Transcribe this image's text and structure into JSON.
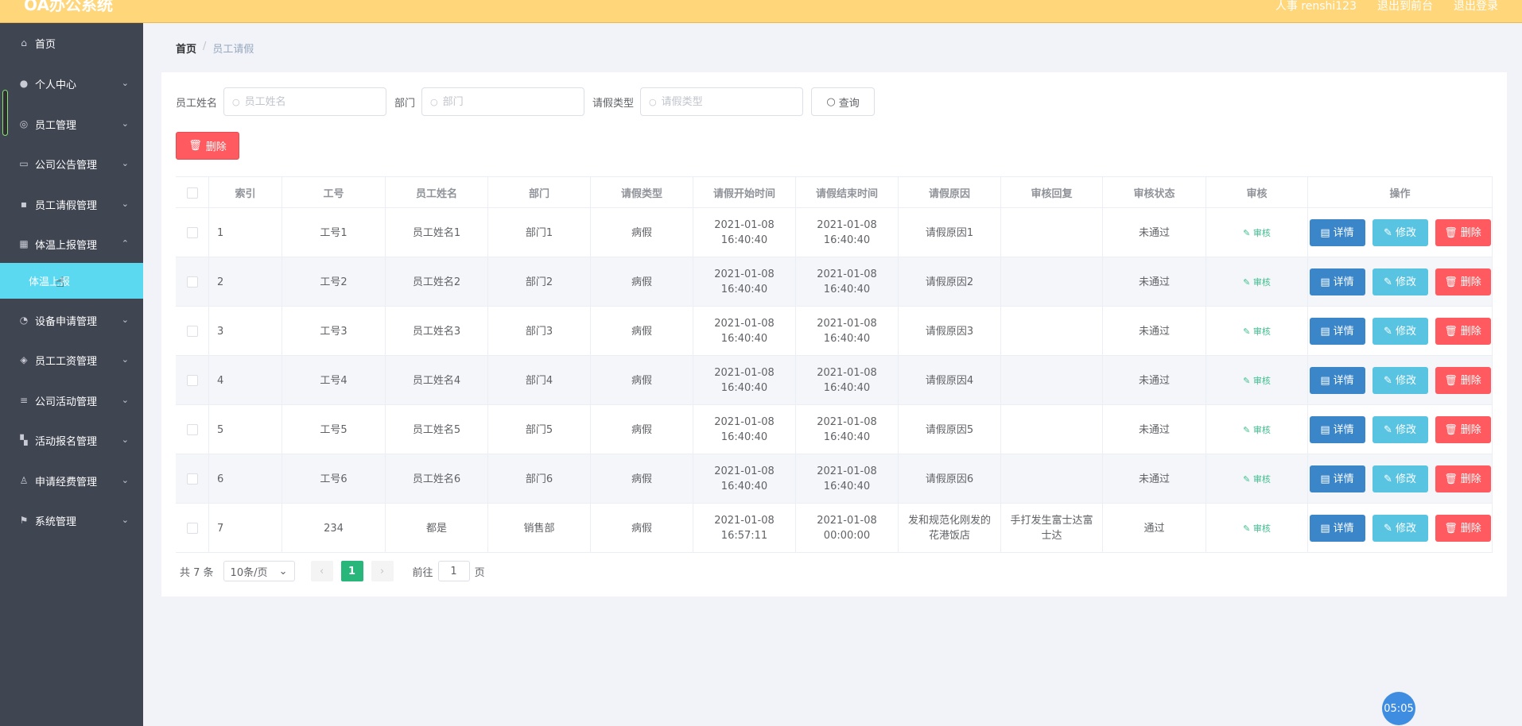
{
  "header": {
    "brand": "OA办公系统",
    "user": "人事 renshi123",
    "back_link": "退出到前台",
    "logout": "退出登录"
  },
  "sidebar": {
    "items": [
      {
        "label": "首页",
        "icon": "home-icon"
      },
      {
        "label": "个人中心",
        "icon": "user-icon"
      },
      {
        "label": "员工管理",
        "icon": "globe-icon"
      },
      {
        "label": "公司公告管理",
        "icon": "notice-icon"
      },
      {
        "label": "员工请假管理",
        "icon": "chat-icon"
      },
      {
        "label": "体温上报管理",
        "icon": "briefcase-icon"
      },
      {
        "label": "设备申请管理",
        "icon": "gauge-icon"
      },
      {
        "label": "员工工资管理",
        "icon": "pin-icon"
      },
      {
        "label": "公司活动管理",
        "icon": "list-icon"
      },
      {
        "label": "活动报名管理",
        "icon": "grid-icon"
      },
      {
        "label": "申请经费管理",
        "icon": "person-icon"
      },
      {
        "label": "系统管理",
        "icon": "flag-icon"
      }
    ],
    "active_sub": "体温上报"
  },
  "breadcrumb": {
    "home": "首页",
    "separator": "/",
    "current": "员工请假"
  },
  "search": {
    "name_label": "员工姓名",
    "name_placeholder": "员工姓名",
    "dept_label": "部门",
    "dept_placeholder": "部门",
    "type_label": "请假类型",
    "type_placeholder": "请假类型",
    "query_label": "查询"
  },
  "toolbar": {
    "delete_label": "删除"
  },
  "table": {
    "headers": [
      "索引",
      "工号",
      "员工姓名",
      "部门",
      "请假类型",
      "请假开始时间",
      "请假结束时间",
      "请假原因",
      "审核回复",
      "审核状态",
      "审核",
      "操作"
    ],
    "audit_label": "审核",
    "action_labels": {
      "detail": "详情",
      "edit": "修改",
      "delete": "删除"
    },
    "rows": [
      {
        "index": "1",
        "id": "工号1",
        "name": "员工姓名1",
        "dept": "部门1",
        "type": "病假",
        "start": "2021-01-08 16:40:40",
        "end": "2021-01-08 16:40:40",
        "reason": "请假原因1",
        "reply": "",
        "status": "未通过"
      },
      {
        "index": "2",
        "id": "工号2",
        "name": "员工姓名2",
        "dept": "部门2",
        "type": "病假",
        "start": "2021-01-08 16:40:40",
        "end": "2021-01-08 16:40:40",
        "reason": "请假原因2",
        "reply": "",
        "status": "未通过"
      },
      {
        "index": "3",
        "id": "工号3",
        "name": "员工姓名3",
        "dept": "部门3",
        "type": "病假",
        "start": "2021-01-08 16:40:40",
        "end": "2021-01-08 16:40:40",
        "reason": "请假原因3",
        "reply": "",
        "status": "未通过"
      },
      {
        "index": "4",
        "id": "工号4",
        "name": "员工姓名4",
        "dept": "部门4",
        "type": "病假",
        "start": "2021-01-08 16:40:40",
        "end": "2021-01-08 16:40:40",
        "reason": "请假原因4",
        "reply": "",
        "status": "未通过"
      },
      {
        "index": "5",
        "id": "工号5",
        "name": "员工姓名5",
        "dept": "部门5",
        "type": "病假",
        "start": "2021-01-08 16:40:40",
        "end": "2021-01-08 16:40:40",
        "reason": "请假原因5",
        "reply": "",
        "status": "未通过"
      },
      {
        "index": "6",
        "id": "工号6",
        "name": "员工姓名6",
        "dept": "部门6",
        "type": "病假",
        "start": "2021-01-08 16:40:40",
        "end": "2021-01-08 16:40:40",
        "reason": "请假原因6",
        "reply": "",
        "status": "未通过"
      },
      {
        "index": "7",
        "id": "234",
        "name": "都是",
        "dept": "销售部",
        "type": "病假",
        "start": "2021-01-08 16:57:11",
        "end": "2021-01-08 00:00:00",
        "reason": "发和规范化刚发的花港饭店",
        "reply": "手打发生富士达富士达",
        "status": "通过"
      }
    ]
  },
  "pagination": {
    "total": "共 7 条",
    "page_size": "10条/页",
    "current_page": "1",
    "goto_label": "前往",
    "goto_value": "1",
    "page_suffix": "页"
  },
  "timer": "05:05",
  "colors": {
    "header": "#ffd67a",
    "sidebar": "#404552",
    "active_submenu": "#5bd9f0",
    "detail": "#3a86c8",
    "edit": "#59c4e1",
    "delete": "#ff5a5f",
    "page_active": "#28b67a"
  }
}
